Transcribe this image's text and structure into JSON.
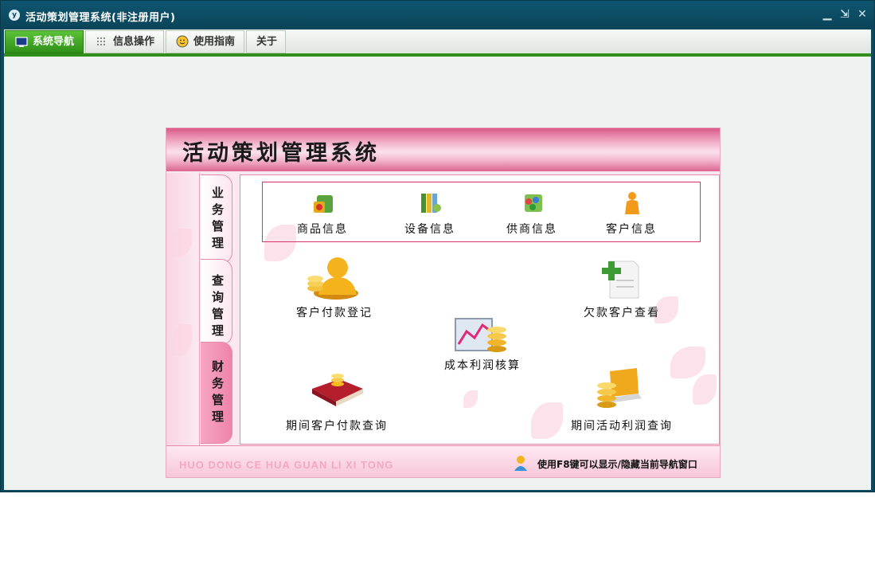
{
  "window": {
    "title": "活动策划管理系统(非注册用户)",
    "app_icon_letter": "y"
  },
  "menu": {
    "tabs": [
      {
        "label": "系统导航",
        "icon": "monitor-icon",
        "active": true
      },
      {
        "label": "信息操作",
        "icon": "grid-icon",
        "active": false
      },
      {
        "label": "使用指南",
        "icon": "smiley-icon",
        "active": false
      },
      {
        "label": "关于",
        "icon": "",
        "active": false
      }
    ]
  },
  "panel": {
    "title": "活动策划管理系统",
    "side_tabs": [
      {
        "label": "业务管理",
        "active": false
      },
      {
        "label": "查询管理",
        "active": false
      },
      {
        "label": "财务管理",
        "active": true
      }
    ],
    "info_items": [
      {
        "label": "商品信息",
        "icon": "goods-icon"
      },
      {
        "label": "设备信息",
        "icon": "equipment-icon"
      },
      {
        "label": "供商信息",
        "icon": "supplier-icon"
      },
      {
        "label": "客户信息",
        "icon": "customer-icon"
      }
    ],
    "finance_items": {
      "payment_register": "客户付款登记",
      "debt_view": "欠款客户查看",
      "profit_calc": "成本利润核算",
      "period_payment_query": "期间客户付款查询",
      "period_profit_query": "期间活动利润查询"
    },
    "footer_pinyin": "HUO DONG CE HUA GUAN LI XI TONG",
    "footer_hint": "使用F8键可以显示/隐藏当前导航窗口"
  },
  "colors": {
    "titlebar": "#0a4458",
    "active_tab": "#2e8f17",
    "accent_pink": "#d9336b"
  }
}
